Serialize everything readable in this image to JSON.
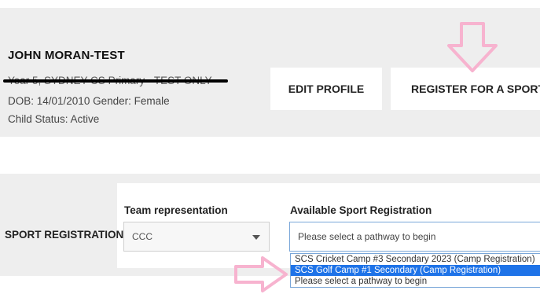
{
  "profile": {
    "name": "JOHN MORAN-TEST",
    "school_line": "Year 5, SYDNEY CS Primary - TEST ONLY",
    "dob_line": "DOB: 14/01/2010 Gender: Female",
    "status_line": "Child Status: Active"
  },
  "buttons": {
    "edit_profile": "EDIT PROFILE",
    "register_sport": "REGISTER FOR A SPORT"
  },
  "registration": {
    "section_label": "SPORT REGISTRATION",
    "team_label": "Team representation",
    "team_value": "CCC",
    "available_label": "Available Sport Registration",
    "available_placeholder": "Please select a pathway to begin",
    "options": [
      "SCS Cricket Camp #3 Secondary 2023 (Camp Registration)",
      "SCS Golf Camp #1 Secondary (Camp Registration)",
      "Please select a pathway to begin"
    ],
    "selected_index": 1
  },
  "colors": {
    "panel_bg": "#eeeeee",
    "arrow": "#f7b3cf",
    "selected_option": "#1e73e8"
  },
  "icons": {
    "annotation_arrow_down": "pink-down-arrow-icon",
    "annotation_arrow_right": "pink-right-arrow-icon",
    "select_caret": "caret-down-icon"
  }
}
